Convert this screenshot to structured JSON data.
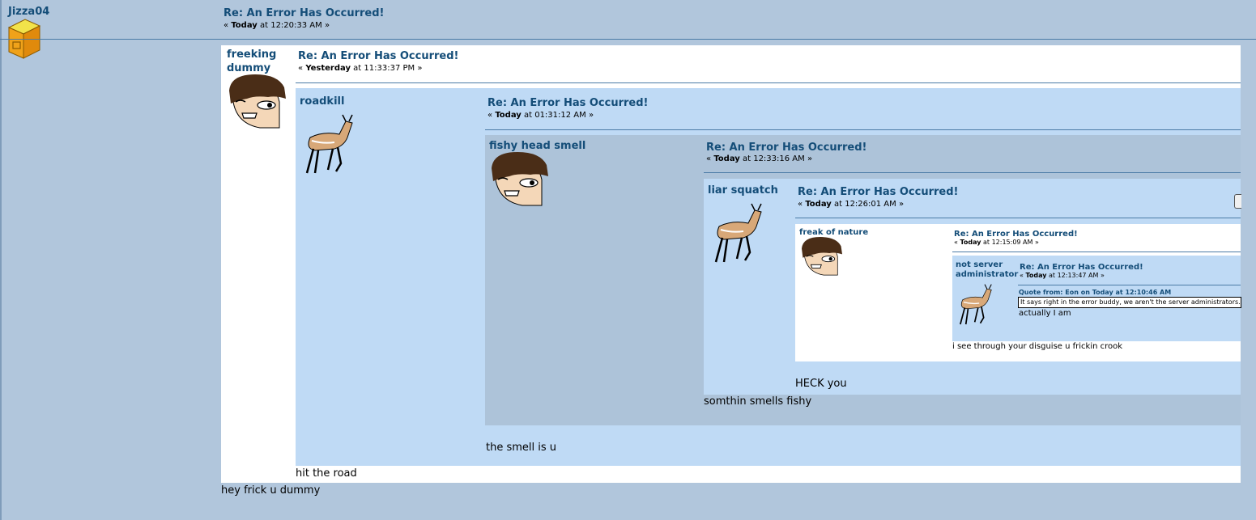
{
  "post": {
    "author": "Jizza04",
    "title": "Re: An Error Has Occurred!",
    "date_prefix": "«",
    "date_day": "Today",
    "date_rest": "at 12:20:33 AM »",
    "message": "hey frick u dummy"
  },
  "quotes": [
    {
      "author": "freeking dummy",
      "title": "Re: An Error Has Occurred!",
      "date_prefix": "«",
      "date_day": "Yesterday",
      "date_rest": "at 11:33:37 PM »",
      "message": "hit the road",
      "avatar": "face-avatar"
    },
    {
      "author": "roadkill",
      "title": "Re: An Error Has Occurred!",
      "date_prefix": "«",
      "date_day": "Today",
      "date_rest": "at 01:31:12 AM »",
      "message": "the smell is u",
      "avatar": "deer-avatar"
    },
    {
      "author": "fishy head smell",
      "title": "Re: An Error Has Occurred!",
      "date_prefix": "«",
      "date_day": "Today",
      "date_rest": "at 12:33:16 AM »",
      "message": "somthin smells fishy",
      "avatar": "face-avatar"
    },
    {
      "author": "liar squatch",
      "title": "Re: An Error Has Occurred!",
      "date_prefix": "«",
      "date_day": "Today",
      "date_rest": "at 12:26:01 AM »",
      "message": "HECK you",
      "avatar": "deer-avatar"
    },
    {
      "author": "freak of nature",
      "title": "Re: An Error Has Occurred!",
      "date_prefix": "«",
      "date_day": "Today",
      "date_rest": "at 12:15:09 AM »",
      "message": "i see through your disguise u frickin crook",
      "avatar": "face-avatar"
    },
    {
      "author_line1": "not server",
      "author_line2": "administrator",
      "title": "Re: An Error Has Occurred!",
      "date_prefix": "«",
      "date_day": "Today",
      "date_rest": "at 12:13:47 AM »",
      "message": "actually I am",
      "avatar": "deer-avatar",
      "quote_header": "Quote from: Eon on Today at 12:10:46 AM",
      "quote_text": "It says right in the error buddy, we aren't the server administrators."
    }
  ],
  "colors": {
    "page_bg": "#b1c6dc",
    "light_panel": "#bfdaf5",
    "mid_panel": "#adc3d9",
    "white_panel": "#ffffff",
    "link": "#144d78"
  }
}
